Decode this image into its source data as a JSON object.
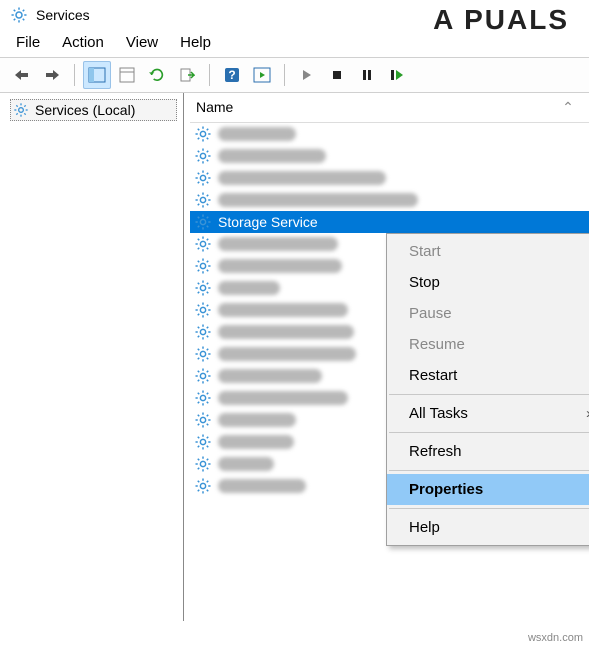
{
  "window": {
    "title": "Services"
  },
  "menubar": {
    "file": "File",
    "action": "Action",
    "view": "View",
    "help": "Help"
  },
  "tree": {
    "root_label": "Services (Local)"
  },
  "list": {
    "header": {
      "name": "Name"
    },
    "selected_service": "Storage Service",
    "blurred_widths": [
      78,
      108,
      168,
      200,
      120,
      124,
      62,
      130,
      136,
      138,
      104,
      130,
      78,
      76,
      56,
      88
    ]
  },
  "context_menu": {
    "start": "Start",
    "stop": "Stop",
    "pause": "Pause",
    "resume": "Resume",
    "restart": "Restart",
    "all_tasks": "All Tasks",
    "refresh": "Refresh",
    "properties": "Properties",
    "help": "Help"
  },
  "watermark": "A  PUALS",
  "credit": "wsxdn.com"
}
